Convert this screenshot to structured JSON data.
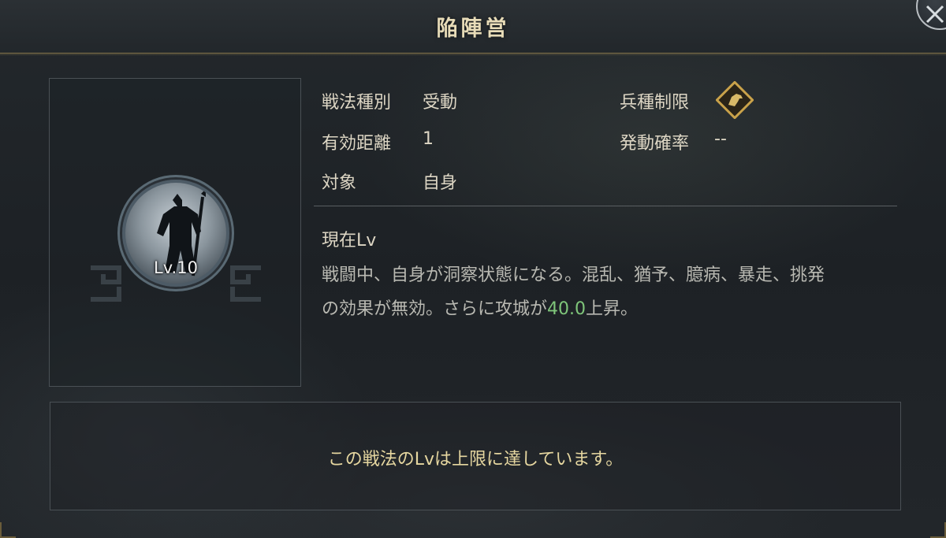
{
  "title": "陥陣営",
  "skill": {
    "level": "Lv.10"
  },
  "info": {
    "type_label": "戦法種別",
    "type_value": "受動",
    "range_label": "有効距離",
    "range_value": "1",
    "target_label": "対象",
    "target_value": "自身",
    "troop_label": "兵種制限",
    "troop_icon": "cavalry-horse-icon",
    "rate_label": "発動確率",
    "rate_value": "--"
  },
  "current": {
    "heading": "現在Lv",
    "desc_line1": "戦闘中、自身が洞察状態になる。混乱、猶予、臆病、暴走、挑発",
    "desc_line2_pre": "の効果が無効。さらに攻城が",
    "desc_number": "40.0",
    "desc_line2_post": "上昇。"
  },
  "message": "この戦法のLvは上限に達しています。",
  "colors": {
    "accent_gold": "#e6d7a0",
    "highlight_green": "#7fc67a",
    "badge_gold": "#c9a24a"
  }
}
